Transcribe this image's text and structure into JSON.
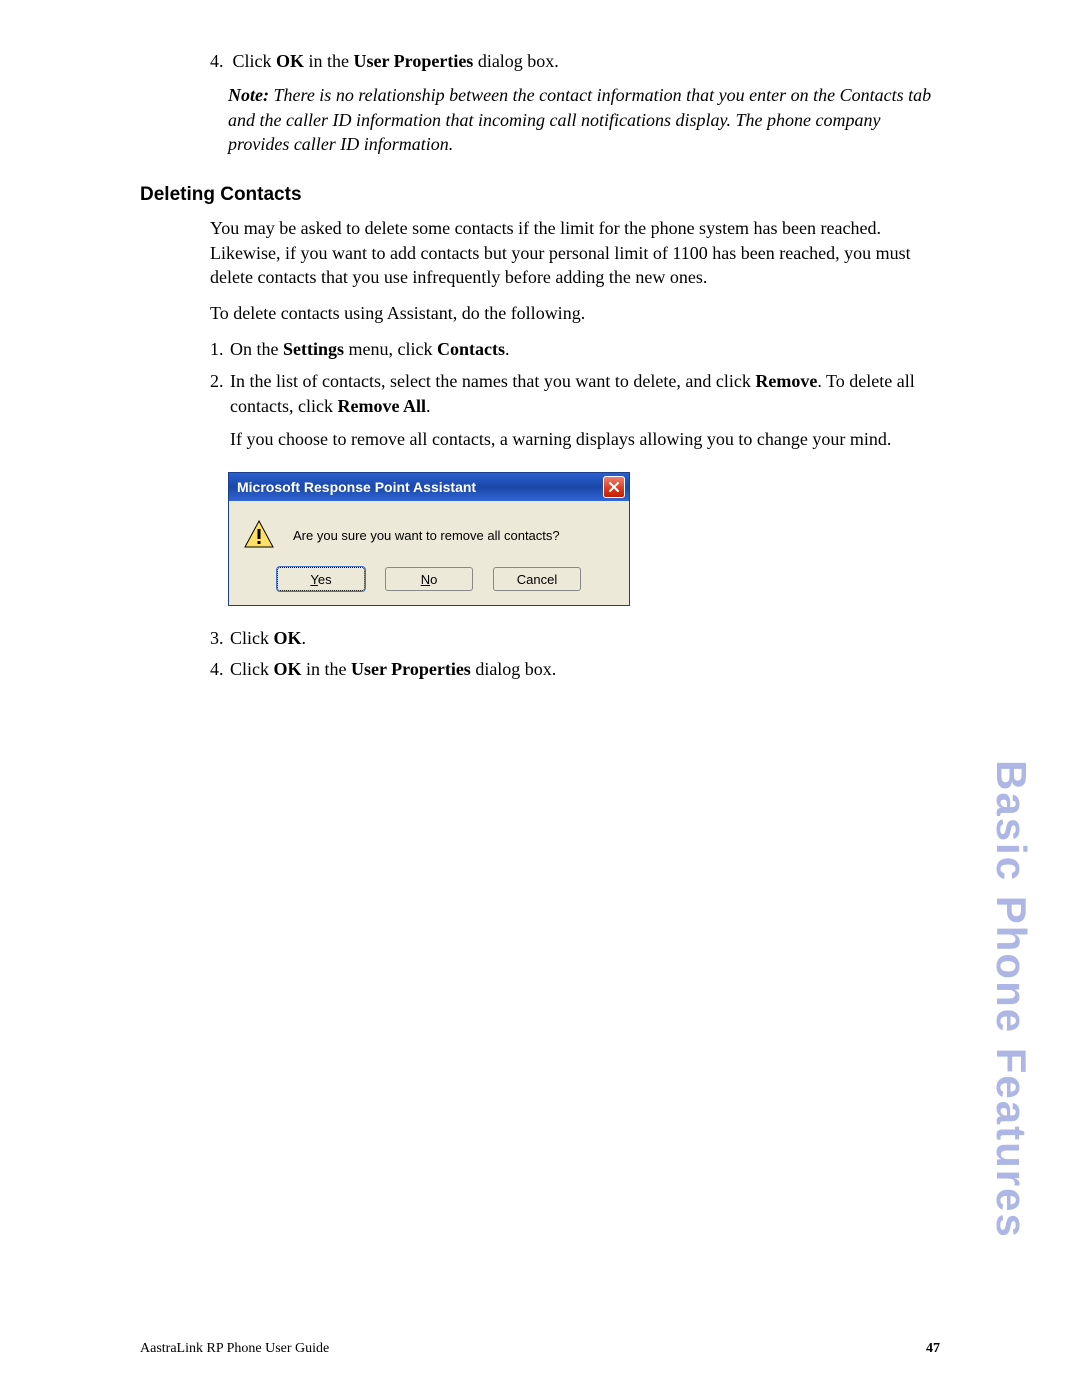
{
  "top_step4": {
    "num": "4.",
    "prefix": "Click ",
    "bold1": "OK",
    "mid": " in the ",
    "bold2": "User Properties",
    "suffix": " dialog box."
  },
  "note": {
    "label": "Note:",
    "text": " There is no relationship between the contact information that you enter on the Contacts tab and the caller ID information that incoming call notifications display. The phone company provides caller ID information."
  },
  "section_title": "Deleting Contacts",
  "para1": "You may be asked to delete some contacts if the limit for the phone system has been reached. Likewise, if you want to add contacts but your personal limit of 1100 has been reached, you must delete contacts that you use infrequently before adding the new ones.",
  "para2": "To delete contacts using Assistant, do the following.",
  "step1": {
    "num": "1.",
    "p1": "On the ",
    "b1": "Settings",
    "p2": " menu, click ",
    "b2": "Contacts",
    "p3": "."
  },
  "step2": {
    "num": "2.",
    "p1": "In the list of contacts, select the names that you want to delete, and click ",
    "b1": "Remove",
    "p2": ". To delete all contacts, click ",
    "b2": "Remove All",
    "p3": ".",
    "sub": "If you choose to remove all contacts, a warning displays allowing you to change your mind."
  },
  "dialog": {
    "title": "Microsoft Response Point Assistant",
    "message": "Are you sure you want to remove all contacts?",
    "yes_u": "Y",
    "yes_rest": "es",
    "no_u": "N",
    "no_rest": "o",
    "cancel": "Cancel"
  },
  "step3": {
    "num": "3.",
    "p1": "Click ",
    "b1": "OK",
    "p2": "."
  },
  "step4b": {
    "num": "4.",
    "p1": "Click ",
    "b1": "OK",
    "p2": " in the ",
    "b2": "User Properties",
    "p3": " dialog box."
  },
  "side_tab": "Basic Phone Features",
  "footer": {
    "left": "AastraLink RP Phone User Guide",
    "page": "47"
  }
}
